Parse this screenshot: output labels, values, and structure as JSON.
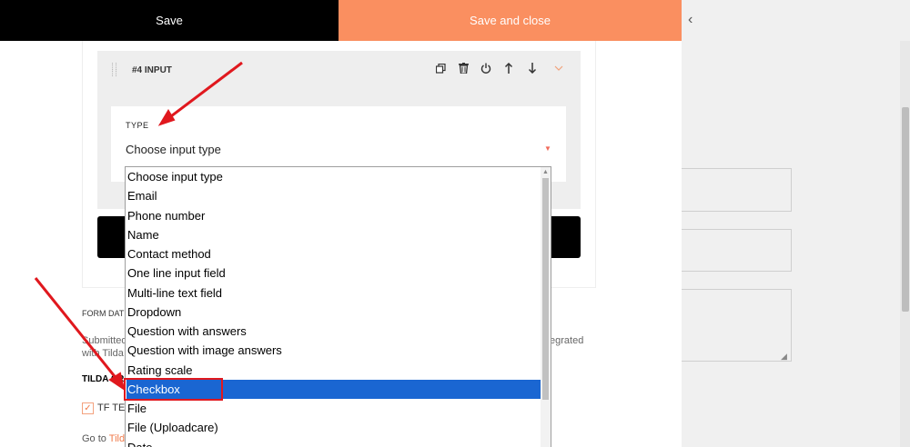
{
  "toolbar": {
    "save_label": "Save",
    "save_close_label": "Save and close",
    "collapse_icon": "‹"
  },
  "block": {
    "title": "#4 INPUT",
    "icons": [
      "copy-icon",
      "trash-icon",
      "power-icon",
      "arrow-up-icon",
      "arrow-down-icon",
      "chevron-down-icon"
    ]
  },
  "type_field": {
    "label": "TYPE",
    "value": "Choose input type",
    "options": [
      "Choose input type",
      "Email",
      "Phone number",
      "Name",
      "Contact method",
      "One line input field",
      "Multi-line text field",
      "Dropdown",
      "Question with answers",
      "Question with image answers",
      "Rating scale",
      "Checkbox",
      "File",
      "File (Uploadcare)",
      "Date"
    ],
    "selected_index": 11
  },
  "form_data": {
    "label": "FORM DAT",
    "submitted": "Submitted",
    "with_tilda": "with Tilda",
    "integrated": "egrated",
    "tilda_heading": "TILDA CR",
    "tf_label": "TF TE",
    "goto_prefix": "Go to ",
    "goto_link": "Tild"
  },
  "colors": {
    "accent": "#fa8f60",
    "selection": "#1a66d2",
    "annotation": "#e0181e"
  }
}
